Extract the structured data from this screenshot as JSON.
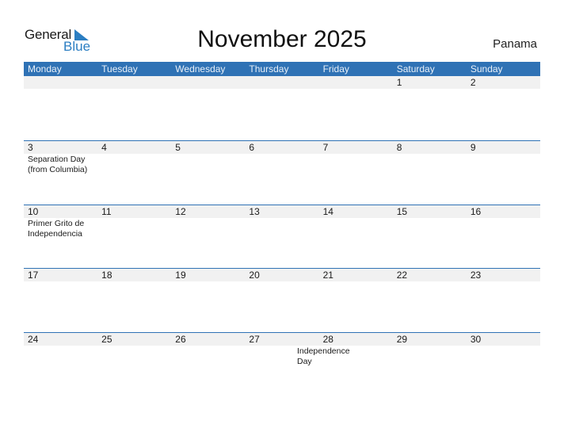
{
  "logo": {
    "text_general": "General",
    "text_blue": "Blue"
  },
  "title": "November 2025",
  "country": "Panama",
  "colors": {
    "header_bg": "#2f72b5",
    "accent": "#2b7ec2",
    "day_band": "#f1f1f1"
  },
  "weekdays": [
    "Monday",
    "Tuesday",
    "Wednesday",
    "Thursday",
    "Friday",
    "Saturday",
    "Sunday"
  ],
  "weeks": [
    {
      "days": [
        "",
        "",
        "",
        "",
        "",
        "1",
        "2"
      ],
      "events": [
        "",
        "",
        "",
        "",
        "",
        "",
        ""
      ]
    },
    {
      "days": [
        "3",
        "4",
        "5",
        "6",
        "7",
        "8",
        "9"
      ],
      "events": [
        "Separation Day (from Columbia)",
        "",
        "",
        "",
        "",
        "",
        ""
      ]
    },
    {
      "days": [
        "10",
        "11",
        "12",
        "13",
        "14",
        "15",
        "16"
      ],
      "events": [
        "Primer Grito de Independencia",
        "",
        "",
        "",
        "",
        "",
        ""
      ]
    },
    {
      "days": [
        "17",
        "18",
        "19",
        "20",
        "21",
        "22",
        "23"
      ],
      "events": [
        "",
        "",
        "",
        "",
        "",
        "",
        ""
      ]
    },
    {
      "days": [
        "24",
        "25",
        "26",
        "27",
        "28",
        "29",
        "30"
      ],
      "events": [
        "",
        "",
        "",
        "",
        "Independence Day",
        "",
        ""
      ]
    }
  ]
}
